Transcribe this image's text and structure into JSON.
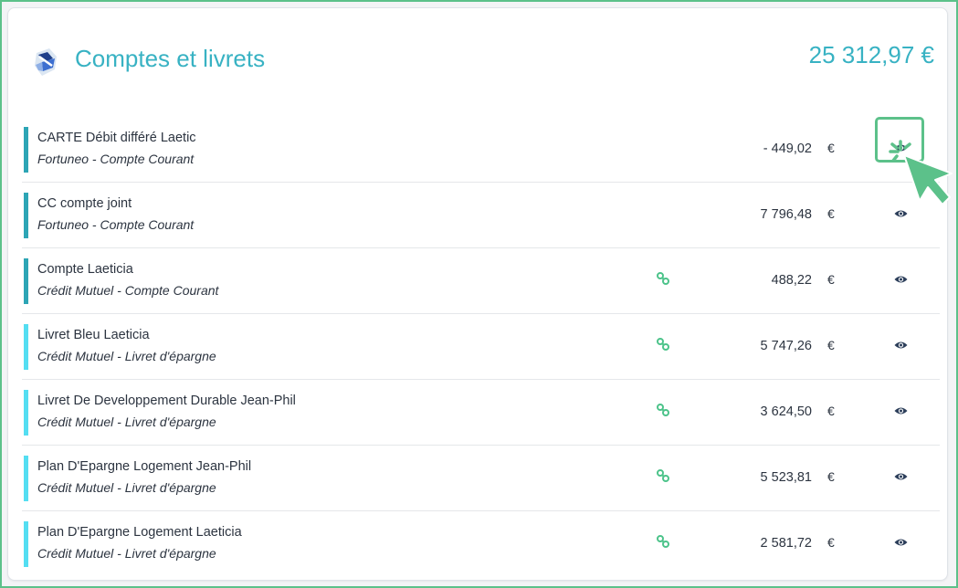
{
  "header": {
    "title": "Comptes et livrets",
    "total": "25 312,97 €",
    "logo_icon": "bank-logo-icon"
  },
  "accounts": [
    {
      "name": "CARTE Débit différé Laetic",
      "bank": "Fortuneo - Compte Courant",
      "amount": "- 449,02",
      "currency": "€",
      "linked": false,
      "type": "courant"
    },
    {
      "name": "CC compte joint",
      "bank": "Fortuneo - Compte Courant",
      "amount": "7 796,48",
      "currency": "€",
      "linked": false,
      "type": "courant"
    },
    {
      "name": "Compte Laeticia",
      "bank": "Crédit Mutuel - Compte Courant",
      "amount": "488,22",
      "currency": "€",
      "linked": true,
      "type": "courant"
    },
    {
      "name": "Livret Bleu Laeticia",
      "bank": "Crédit Mutuel - Livret d'épargne",
      "amount": "5 747,26",
      "currency": "€",
      "linked": true,
      "type": "livret"
    },
    {
      "name": "Livret De Developpement Durable Jean-Phil",
      "bank": "Crédit Mutuel - Livret d'épargne",
      "amount": "3 624,50",
      "currency": "€",
      "linked": true,
      "type": "livret"
    },
    {
      "name": "Plan D'Epargne Logement Jean-Phil",
      "bank": "Crédit Mutuel - Livret d'épargne",
      "amount": "5 523,81",
      "currency": "€",
      "linked": true,
      "type": "livret"
    },
    {
      "name": "Plan D'Epargne Logement Laeticia",
      "bank": "Crédit Mutuel - Livret d'épargne",
      "amount": "2 581,72",
      "currency": "€",
      "linked": true,
      "type": "livret"
    }
  ],
  "colors": {
    "accent": "#38b2c3",
    "courant_bar": "#2da5b5",
    "livret_bar": "#54def2",
    "link_green": "#4cc38a",
    "highlight_green": "#5cc18a",
    "eye_dark": "#2c3e5a"
  },
  "icons": {
    "link": "link-icon",
    "eye": "eye-icon",
    "cursor": "pointer-cursor-icon"
  }
}
